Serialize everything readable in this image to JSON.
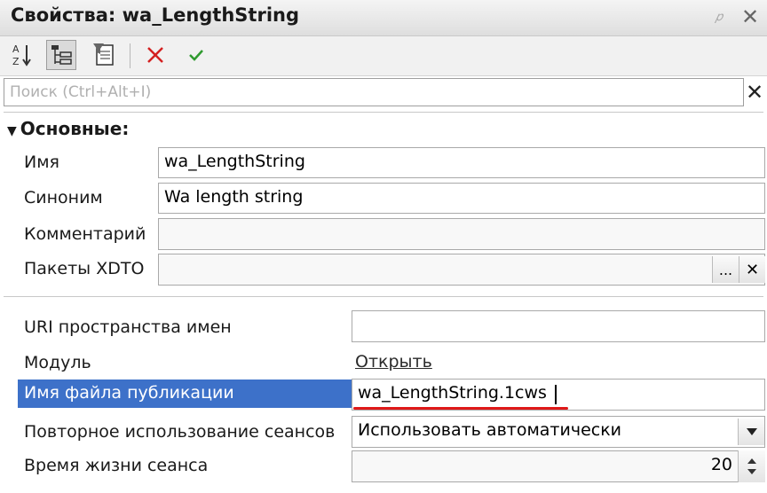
{
  "window": {
    "title": "Свойства: wa_LengthString",
    "close_glyph": "✕",
    "pin_glyph": "𝑝"
  },
  "toolbar": {
    "sort_icon": "sort-az-icon",
    "categories_icon": "categories-tree-icon",
    "filter_icon": "filter-list-icon",
    "delete_icon": "delete-x-icon",
    "apply_icon": "apply-check-icon"
  },
  "search": {
    "placeholder": "Поиск (Ctrl+Alt+I)",
    "clear_glyph": "✕"
  },
  "section": {
    "title": "Основные:"
  },
  "props": {
    "name_label": "Имя",
    "name_value": "wa_LengthString",
    "synonym_label": "Синоним",
    "synonym_value": "Wa length string",
    "comment_label": "Комментарий",
    "comment_value": "",
    "xdto_label": "Пакеты XDTO",
    "xdto_value": "",
    "xdto_choose": "...",
    "xdto_clear": "✕",
    "uri_label": "URI пространства имен",
    "uri_value": "",
    "module_label": "Модуль",
    "module_link": "Открыть",
    "pubfile_label": "Имя файла публикации",
    "pubfile_value": "wa_LengthString.1cws",
    "reuse_label": "Повторное использование сеансов",
    "reuse_value": "Использовать автоматически",
    "lifetime_label": "Время жизни сеанса",
    "lifetime_value": "20"
  },
  "colors": {
    "selection": "#3d71c9",
    "highlight": "#e01818"
  }
}
